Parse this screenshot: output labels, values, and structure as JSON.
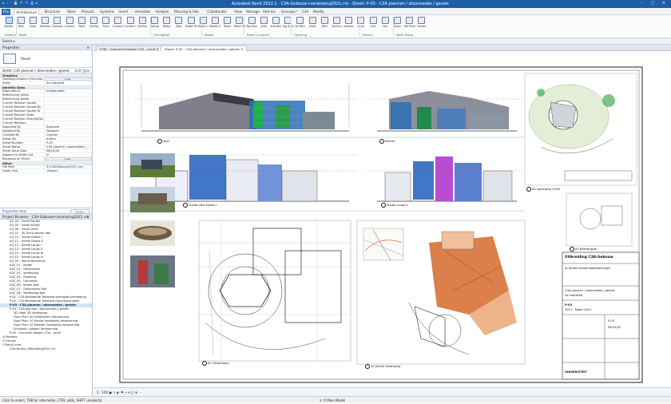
{
  "app": {
    "title": "Autodesk Revit 2022.1 - C3A-Gebouw+verwissing2021.rvt - Sheet: P-03 - C3A plannen / doorsnedes / gevels",
    "quick_access": "⌂ 🗁 💾 ↶ ↷ ⎙ ▸",
    "window_controls": "– ▢ ✕"
  },
  "ribbon": {
    "tabs": [
      {
        "label": "File",
        "kind": "file"
      },
      {
        "label": "Architecture",
        "kind": "active"
      },
      {
        "label": "Structure"
      },
      {
        "label": "Steel"
      },
      {
        "label": "Precast"
      },
      {
        "label": "Systems"
      },
      {
        "label": "Insert"
      },
      {
        "label": "Annotate"
      },
      {
        "label": "Analyze"
      },
      {
        "label": "Massing & Site"
      },
      {
        "label": "Collaborate"
      },
      {
        "label": "View"
      },
      {
        "label": "Manage"
      },
      {
        "label": "Add-Ins"
      },
      {
        "label": "Enscape™"
      },
      {
        "label": "C3A"
      },
      {
        "label": "Modify"
      }
    ],
    "tools": [
      "Modify",
      "Wall",
      "Door",
      "Window",
      "Component",
      "Column",
      "Roof",
      "Ceiling",
      "Floor",
      "Curtain System",
      "Curtain Grid",
      "Mullion",
      "Railing",
      "Ramp",
      "Stair",
      "Model Text",
      "Model Line",
      "Model Group",
      "Room",
      "Room Separator",
      "Tag Room",
      "Area",
      "Area Boundary",
      "Tag Area",
      "By Face",
      "Shaft",
      "Wall",
      "Vertical",
      "Dormer",
      "Level",
      "Grid",
      "Set",
      "Show",
      "Ref Plane",
      "Viewer"
    ],
    "panels": [
      "Select ▾",
      "Build",
      "Circulation",
      "Model",
      "Room & Area ▾",
      "Opening",
      "Datum",
      "Work Plane"
    ]
  },
  "options_bar": {
    "text": "Select ▾"
  },
  "properties": {
    "header": "Properties",
    "close": "✕",
    "type_name": "Sheet",
    "filter_label": "Sheet: C3A plannen / doorsnedes / gevels",
    "edit_type": "Edit Type",
    "groups": [
      {
        "name": "Graphics",
        "rows": [
          {
            "k": "Visibility/Graphics Overrides",
            "v": "Edit...",
            "btn": true
          },
          {
            "k": "Scale",
            "v": "As indicated"
          }
        ]
      },
      {
        "name": "Identity Data",
        "rows": [
          {
            "k": "Dependency",
            "v": "Independent"
          },
          {
            "k": "Referencing Sheet",
            "v": ""
          },
          {
            "k": "Referencing Detail",
            "v": ""
          },
          {
            "k": "Current Revision Issued",
            "v": ""
          },
          {
            "k": "Current Revision Issued By",
            "v": ""
          },
          {
            "k": "Current Revision Issued To",
            "v": ""
          },
          {
            "k": "Current Revision Date",
            "v": ""
          },
          {
            "k": "Current Revision Description",
            "v": ""
          },
          {
            "k": "Current Revision",
            "v": ""
          },
          {
            "k": "Approved By",
            "v": "Approver"
          },
          {
            "k": "Designed By",
            "v": "Designer"
          },
          {
            "k": "Checked By",
            "v": "Checker"
          },
          {
            "k": "Drawn By",
            "v": "Author"
          },
          {
            "k": "Sheet Number",
            "v": "P-03"
          },
          {
            "k": "Sheet Name",
            "v": "C3A plannen / doorsnedes / ..."
          },
          {
            "k": "Sheet Issue Date",
            "v": "08/14/20"
          },
          {
            "k": "Appears In Sheet List",
            "v": "☑"
          },
          {
            "k": "Revisions on Sheet",
            "v": "Edit...",
            "btn": true
          }
        ]
      },
      {
        "name": "Other",
        "rows": [
          {
            "k": "File Path",
            "v": "S:\\C3A\\Gebouw\\2021_ver..."
          },
          {
            "k": "Guide Grid",
            "v": "<None>"
          }
        ]
      }
    ],
    "help": "Properties help",
    "apply": "Apply"
  },
  "project_browser": {
    "header": "Project Browser - C3A-Gebouw+verwissing2021.rvt",
    "items": [
      {
        "d": 1,
        "t": "",
        "l": "A3_04 - Gevel Rechts"
      },
      {
        "d": 1,
        "t": "",
        "l": "A3_05 - Gevel Achter"
      },
      {
        "d": 1,
        "t": "",
        "l": "A3_06 - Gevel Links"
      },
      {
        "d": 1,
        "t": "",
        "l": "A3_07 - 3D Zicht zonder dak"
      },
      {
        "d": 1,
        "t": "",
        "l": "A3_10 - Snede Dwars I"
      },
      {
        "d": 1,
        "t": "",
        "l": "A3_11 - Snede Dwars II"
      },
      {
        "d": 1,
        "t": "",
        "l": "A3_12 - Snede Langs I"
      },
      {
        "d": 1,
        "t": "",
        "l": "A3_13 - Snede Langs II"
      },
      {
        "d": 1,
        "t": "",
        "l": "A3_14 - Snede Langs III"
      },
      {
        "d": 1,
        "t": "",
        "l": "A3_15 - Snede Langs IV"
      },
      {
        "d": 1,
        "t": "",
        "l": "A3_20 - Wand Mondriaan"
      },
      {
        "d": 1,
        "t": "",
        "l": "A3C_01 - Kelder"
      },
      {
        "d": 1,
        "t": "",
        "l": "A3C_02 - Gelijkvloers"
      },
      {
        "d": 1,
        "t": "",
        "l": "A3C_03 - Verdieping"
      },
      {
        "d": 1,
        "t": "",
        "l": "A3C_04 - Ruilering"
      },
      {
        "d": 1,
        "t": "",
        "l": "A3C_05 - Urinamed"
      },
      {
        "d": 1,
        "t": "",
        "l": "A3C_06 - Kelder Dak"
      },
      {
        "d": 1,
        "t": "",
        "l": "A3C_07 - Gelijkvloers Dak"
      },
      {
        "d": 1,
        "t": "",
        "l": "A3C_08 - Verdieping Dak"
      },
      {
        "d": 1,
        "t": "",
        "l": "P-01 - C3A Bestaande Toestand grondplan/verdieping"
      },
      {
        "d": 1,
        "t": "",
        "l": "P-02 - C3A Bestaande Toestand plan/doorsnedes"
      },
      {
        "d": 1,
        "t": "",
        "l": "P-03 - C3A plannen / doorsnedes / gevels",
        "b": true,
        "hl": true
      },
      {
        "d": 1,
        "t": "",
        "l": "P-04 - C3A plannen / doorsnedes / gevels"
      },
      {
        "d": 2,
        "t": "",
        "l": "3D View: 3D Verdieping"
      },
      {
        "d": 2,
        "t": "",
        "l": "Floor Plan: 00 Gelijkvloers Verwarming"
      },
      {
        "d": 2,
        "t": "",
        "l": "Floor Plan: 10 Eerste Verdieping Verwarming"
      },
      {
        "d": 2,
        "t": "",
        "l": "Floor Plan: 20 Tweede Verdieping Verwarming"
      },
      {
        "d": 2,
        "t": "",
        "l": "Schedule: Lokalen Verwarming"
      },
      {
        "d": 1,
        "t": "",
        "l": "P-05 - Overzicht lokalen C3A - privé"
      },
      {
        "d": 0,
        "t": "⊞",
        "l": "Families"
      },
      {
        "d": 0,
        "t": "⊞",
        "l": "Groups"
      },
      {
        "d": 0,
        "t": "⊟",
        "l": "Revit Links"
      },
      {
        "d": 1,
        "t": "",
        "l": "C3A-Terrein_Uitbreiding2021.rvt"
      }
    ]
  },
  "status": {
    "left": "Click to select, TAB for alternates, CTRL adds, SHIFT unselects.",
    "right": "⚲ :0     Main Model"
  },
  "doc_tabs": [
    {
      "label": "P-06 - Overzicht lokalen C3A - privé  ✕"
    },
    {
      "label": "Sheet: P-03 - C3A plannen / doorsnedes / gevels  ✕",
      "active": true
    }
  ],
  "viewports": {
    "voor": "Voor",
    "rechts": "Rechts",
    "snede_dwars": "Snede Udor Dwars I",
    "snede_langs": "Snede Langs II",
    "inplanting": "00 Inplanting 1/250",
    "gelijkvloers": "00 Gelijkvloers",
    "eerste": "10 Eerste Verdieping",
    "kaart": "00 Kaartenplan"
  },
  "title_block": {
    "project": "Uitbreiding C3A-Gebouw",
    "subtitle": "Au Buitsi uitvoeringstekeningen",
    "sheet": "P-03",
    "date": "2021 - Maart 2021",
    "client": "UNIVERSITEIT",
    "lines": [
      "C3A plannen / doorsnedes / gevels",
      "As indicated",
      "P-03",
      "08/14/20"
    ]
  },
  "view_bar": {
    "text": "1 : 100   ▣ ☼ ◐ ⚑ ⌕ ⟲ ◫ ⊕ ⋯"
  },
  "colors": {
    "accent": "#1e5ea4",
    "highlight": "#cfe2f7"
  }
}
